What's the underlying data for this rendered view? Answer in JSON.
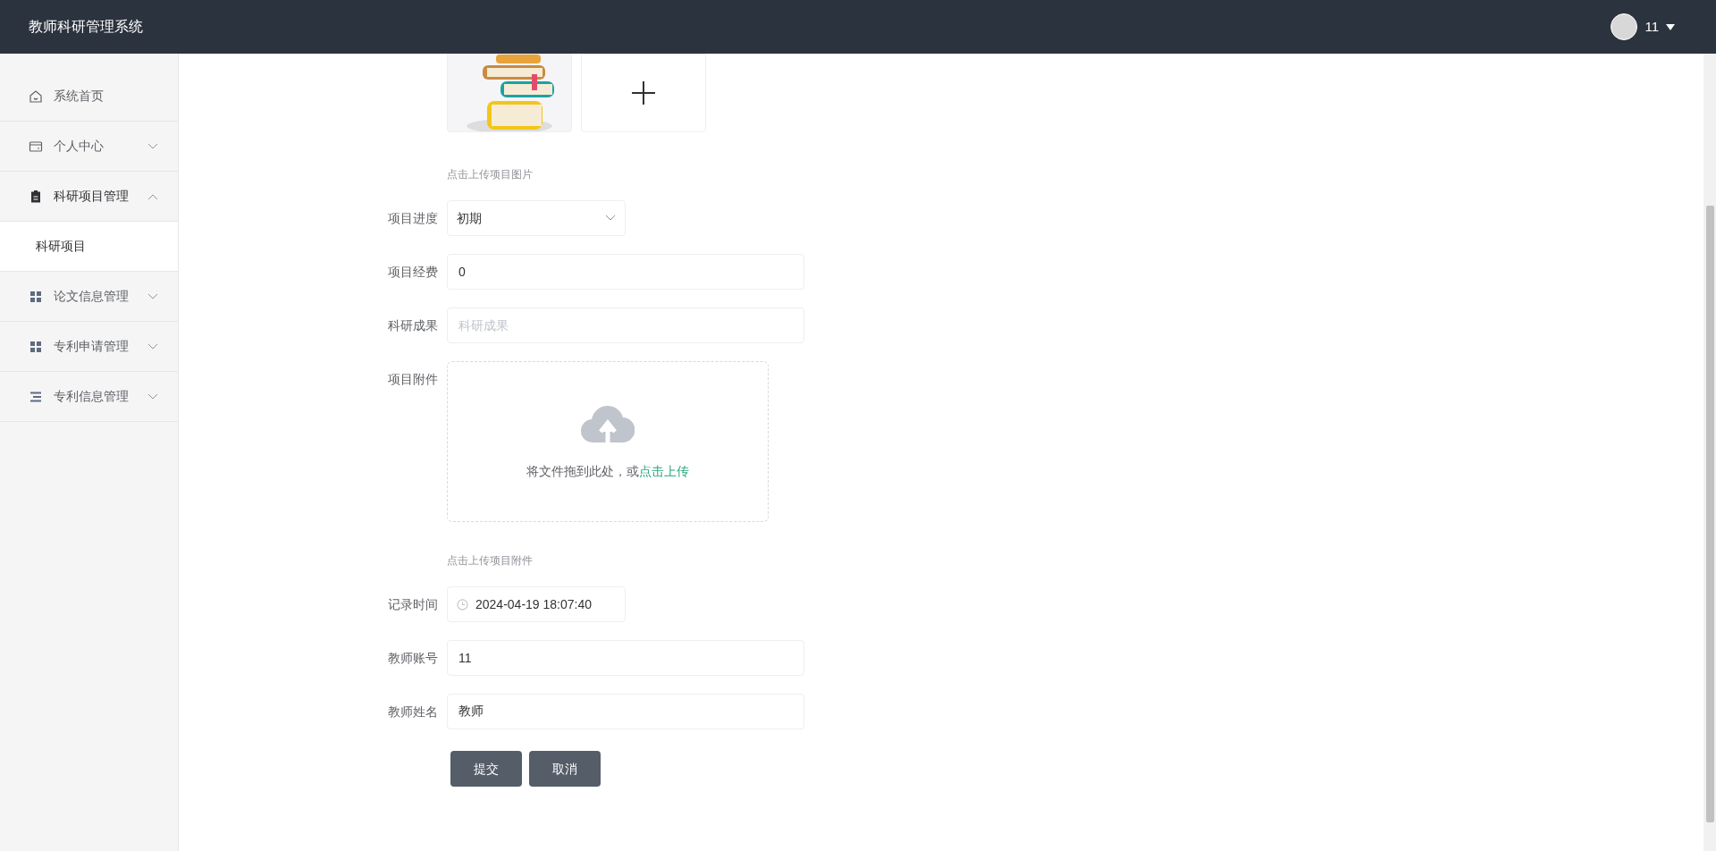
{
  "header": {
    "title": "教师科研管理系统",
    "user": {
      "name": "11"
    }
  },
  "sidebar": {
    "items": [
      {
        "label": "系统首页"
      },
      {
        "label": "个人中心",
        "expanded": false
      },
      {
        "label": "科研项目管理",
        "expanded": true,
        "children": [
          {
            "label": "科研项目",
            "selected": true
          }
        ]
      },
      {
        "label": "论文信息管理",
        "expanded": false
      },
      {
        "label": "专利申请管理",
        "expanded": false
      },
      {
        "label": "专利信息管理",
        "expanded": false
      }
    ]
  },
  "form": {
    "fields": [
      {
        "kind": "image-upload",
        "hint": "点击上传项目图片"
      },
      {
        "kind": "select",
        "label": "项目进度",
        "value": "初期"
      },
      {
        "kind": "input",
        "label": "项目经费",
        "value": "0"
      },
      {
        "kind": "input",
        "label": "科研成果",
        "placeholder": "科研成果"
      },
      {
        "kind": "file-upload",
        "label": "项目附件",
        "text": "将文件拖到此处，或",
        "link": "点击上传",
        "hint": "点击上传项目附件"
      },
      {
        "kind": "date",
        "label": "记录时间",
        "value": "2024-04-19 18:07:40"
      },
      {
        "kind": "input",
        "label": "教师账号",
        "value": "11"
      },
      {
        "kind": "input",
        "label": "教师姓名",
        "value": "教师"
      }
    ],
    "buttons": [
      "提交",
      "取消"
    ]
  }
}
